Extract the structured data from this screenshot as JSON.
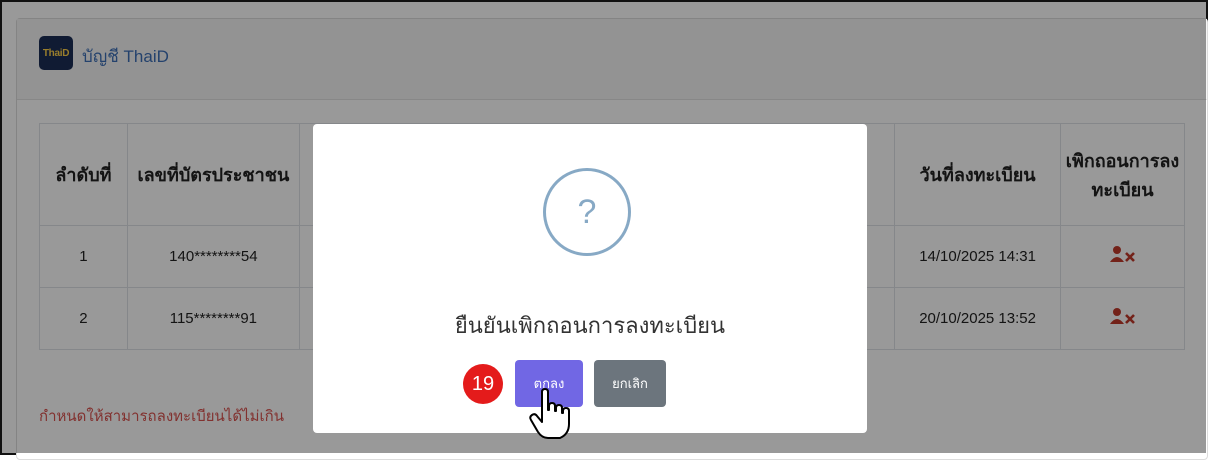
{
  "header": {
    "logo_text": "ThaiD",
    "title": "บัญชี ThaiD"
  },
  "table": {
    "columns": {
      "index": "ลำดับที่",
      "id_number": "เลขที่บัตรประชาชน",
      "reg_date": "วันที่ลงทะเบียน",
      "withdraw": "เพิกถอนการลงทะเบียน"
    },
    "rows": [
      {
        "index": "1",
        "id_number": "140********54",
        "partial": "ı",
        "reg_date": "14/10/2025 14:31",
        "withdraw_icon": "user-remove-icon"
      },
      {
        "index": "2",
        "id_number": "115********91",
        "partial": "ı",
        "reg_date": "20/10/2025 13:52",
        "withdraw_icon": "user-remove-icon"
      }
    ]
  },
  "footer_note": "กำหนดให้สามารถลงทะเบียนได้ไม่เกิน",
  "modal": {
    "icon": "question-icon",
    "icon_glyph": "?",
    "message": "ยืนยันเพิกถอนการลงทะเบียน",
    "confirm_label": "ตกลง",
    "cancel_label": "ยกเลิก"
  },
  "step_badge": "19",
  "colors": {
    "confirm": "#7167e4",
    "cancel": "#6c757d",
    "danger": "#c0392b",
    "badge": "#e41b1b"
  }
}
